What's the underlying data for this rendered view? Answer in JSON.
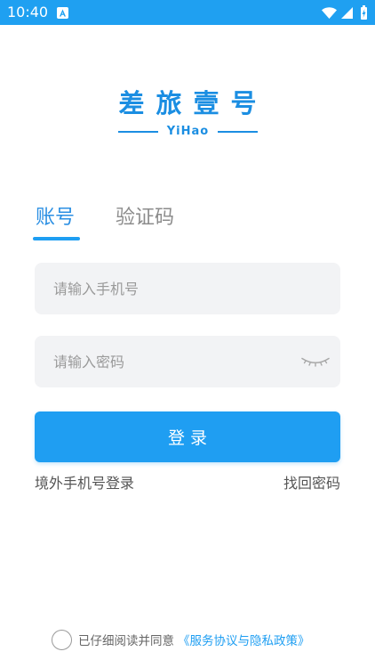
{
  "status_bar": {
    "time": "10:40",
    "icons": [
      "a-letter-icon",
      "wifi-icon",
      "signal-icon",
      "battery-icon"
    ]
  },
  "logo": {
    "title": "差旅壹号",
    "subtitle": "YiHao"
  },
  "tabs": [
    {
      "label": "账号",
      "active": true
    },
    {
      "label": "验证码",
      "active": false
    }
  ],
  "form": {
    "phone": {
      "placeholder": "请输入手机号",
      "value": ""
    },
    "password": {
      "placeholder": "请输入密码",
      "value": "",
      "visibility_icon": "eye-closed-icon"
    },
    "login_label": "登 录"
  },
  "links": {
    "overseas_login": "境外手机号登录",
    "forgot_password": "找回密码"
  },
  "agreement": {
    "checked": false,
    "prefix": "已仔细阅读并同意",
    "link": "《服务协议与隐私政策》"
  },
  "colors": {
    "primary": "#1f9ef2",
    "status_bar": "#1fa0f1",
    "logo": "#1b8ee2",
    "tab_active": "#2b8fe3",
    "tab_inactive": "#8c8c8c",
    "field_bg": "#f2f3f5",
    "placeholder": "#9a9a9a"
  }
}
